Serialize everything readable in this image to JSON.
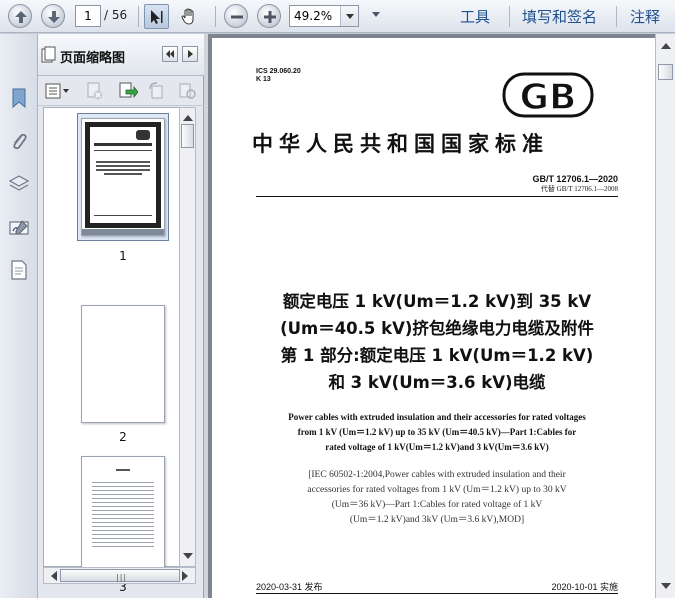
{
  "toolbar": {
    "current_page": "1",
    "page_total": "/ 56",
    "zoom": "49.2%",
    "menu_tools": "工具",
    "menu_fill_sign": "填写和签名",
    "menu_comment": "注释"
  },
  "thumbnails": {
    "panel_title": "页面缩略图",
    "pages": [
      {
        "label": "1",
        "selected": true
      },
      {
        "label": "2",
        "selected": false
      },
      {
        "label": "3",
        "selected": false
      }
    ]
  },
  "document": {
    "ics_line": "ICS 29.060.20",
    "k_line": "K 13",
    "logo_text": "GB",
    "standard_name": "中华人民共和国国家标准",
    "standard_number": "GB/T 12706.1—2020",
    "replaces": "代替 GB/T 12706.1—2008",
    "title_zh": [
      "额定电压 1 kV(Um＝1.2 kV)到 35 kV",
      "(Um＝40.5 kV)挤包绝缘电力电缆及附件",
      "第 1 部分:额定电压 1 kV(Um＝1.2 kV)",
      "和 3 kV(Um＝3.6 kV)电缆"
    ],
    "title_en": [
      "Power cables with extruded insulation and their accessories for rated voltages",
      "from 1 kV (Um＝1.2 kV) up to 35 kV (Um＝40.5 kV)—Part 1:Cables for",
      "rated voltage of 1 kV(Um＝1.2 kV)and 3 kV(Um＝3.6 kV)"
    ],
    "title_iec": [
      "[IEC 60502-1:2004,Power cables with extruded insulation and their",
      "accessories for rated voltages from 1 kV (Um＝1.2 kV) up to 30 kV",
      "(Um＝36 kV)—Part 1:Cables for rated voltage of 1 kV",
      "(Um＝1.2 kV)and 3kV (Um＝3.6 kV),MOD]"
    ],
    "issue_date": "2020-03-31 发布",
    "implement_date": "2020-10-01 实施"
  },
  "colors": {
    "menu_link": "#1f4f8f",
    "doc_background": "#7e8591",
    "panel_background": "#e4e8ee"
  }
}
